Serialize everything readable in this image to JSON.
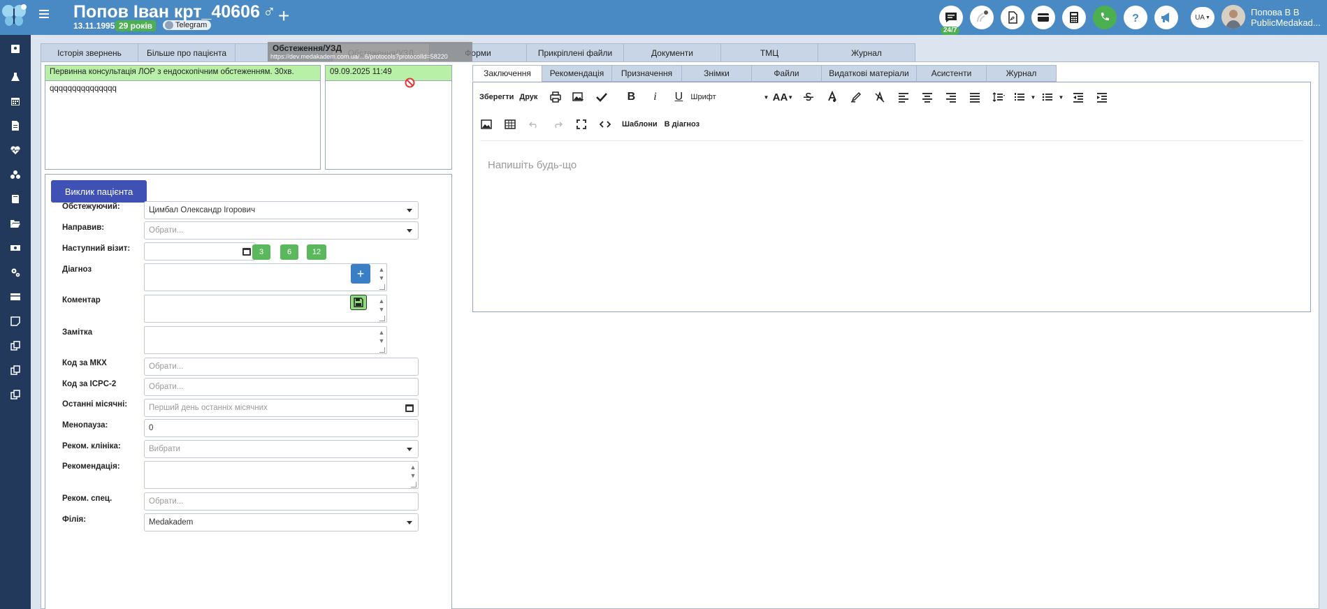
{
  "header": {
    "patient_name": "Попов Іван крт_40606",
    "sex_symbol": "♂",
    "add_symbol": "+",
    "dob": "13.11.1995",
    "age": "29 років",
    "telegram": "Telegram",
    "chat_support": "24/7",
    "lang": "UA",
    "user_name": "Попова В В",
    "user_org": "PublicMedakad...",
    "colors": {
      "bar": "#4a8ac4",
      "green": "#4caf50"
    }
  },
  "tabs": [
    {
      "label": "Історія звернень"
    },
    {
      "label": "Більше про пацієнта"
    },
    {
      "label": ""
    },
    {
      "label": "Обстеження/УЗД"
    },
    {
      "label": "Форми"
    },
    {
      "label": "Прикріплені файли"
    },
    {
      "label": "Документи"
    },
    {
      "label": "ТМЦ"
    },
    {
      "label": "Журнал"
    }
  ],
  "drag_ghost": {
    "title": "Обстеження/УЗД",
    "url": "https://dev.medakadem.com.ua/...6/protocols?protocolId=58220"
  },
  "protocol": {
    "title": "Первинна консультація ЛОР з ендоскопічним обстеженням. 30хв.",
    "text": "qqqqqqqqqqqqqqq",
    "date": "09.09.2025 11:49"
  },
  "form": {
    "call_button": "Виклик пацієнта",
    "examiner_label": "Обстежуючий:",
    "examiner_value": "Цимбал Олександр Ігорович",
    "referrer_label": "Направив:",
    "referrer_placeholder": "Обрати...",
    "next_visit_label": "Наступний візит:",
    "quick": [
      "3",
      "6",
      "12"
    ],
    "diagnosis_label": "Діагноз",
    "comment_label": "Коментар",
    "note_label": "Замітка",
    "mkh_label": "Код за МКХ",
    "mkh_placeholder": "Обрати...",
    "icpc_label": "Код за ICPC-2",
    "icpc_placeholder": "Обрати...",
    "menses_label": "Останні місячні:",
    "menses_placeholder": "Перший день останніх місячних",
    "menopause_label": "Менопауза:",
    "menopause_value": "0",
    "clinic_label": "Реком. клініка:",
    "clinic_placeholder": "Вибрати",
    "recom_label": "Рекомендація:",
    "spec_label": "Реком. спец.",
    "spec_placeholder": "Обрати...",
    "branch_label": "Філія:",
    "branch_value": "Medakadem"
  },
  "editor_tabs": [
    {
      "label": "Заключення"
    },
    {
      "label": "Рекомендація"
    },
    {
      "label": "Призначення"
    },
    {
      "label": "Знімки"
    },
    {
      "label": "Файли"
    },
    {
      "label": "Видаткові матеріали"
    },
    {
      "label": "Асистенти"
    },
    {
      "label": "Журнал"
    }
  ],
  "editor": {
    "save": "Зберегти",
    "print": "Друк",
    "font": "Шрифт",
    "font_size": "AA",
    "templates": "Шаблони",
    "to_diagnosis": "В діагноз",
    "placeholder": "Напишіть будь-що"
  }
}
